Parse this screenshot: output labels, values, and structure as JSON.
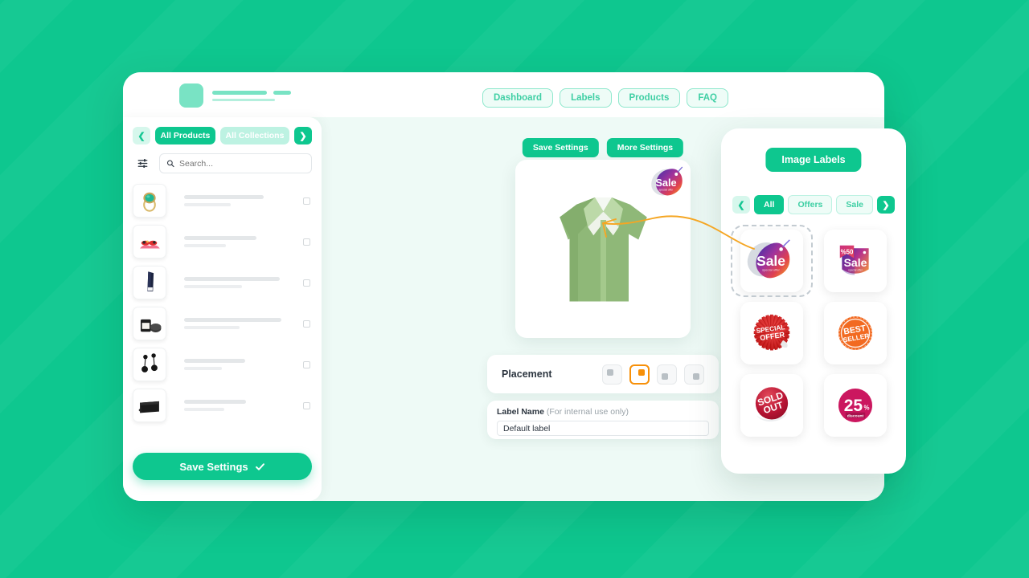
{
  "theme": {
    "brand_green": "#0ec78f",
    "light_green": "#eefcf7",
    "canvas": "#eefaf6",
    "accent_orange": "#f79009"
  },
  "header": {
    "logo_name": "app-logo",
    "nav_tabs": [
      {
        "label": "Dashboard"
      },
      {
        "label": "Labels"
      },
      {
        "label": "Products"
      },
      {
        "label": "FAQ"
      }
    ]
  },
  "sidebar": {
    "prev_icon": "chevron-left-icon",
    "next_icon": "chevron-right-icon",
    "segments": [
      {
        "label": "All Products",
        "active": true
      },
      {
        "label": "All Collections",
        "active": false
      }
    ],
    "filter_icon": "sliders-icon",
    "search": {
      "icon": "search-icon",
      "placeholder": "Search...",
      "value": ""
    },
    "products": [
      {
        "name": "product-ring",
        "checked": false
      },
      {
        "name": "product-sandals",
        "checked": false
      },
      {
        "name": "product-scarf",
        "checked": false
      },
      {
        "name": "product-candle",
        "checked": false
      },
      {
        "name": "product-earrings",
        "checked": false
      },
      {
        "name": "product-wallet",
        "checked": false
      }
    ],
    "save_button": {
      "label": "Save Settings",
      "icon": "check-icon"
    }
  },
  "center": {
    "buttons": [
      {
        "label": "Save Settings"
      },
      {
        "label": "More Settings"
      }
    ],
    "preview": {
      "product": "green-shirt",
      "badge_text": "Sale",
      "badge_sub": "special offer"
    },
    "placement": {
      "label": "Placement",
      "options": [
        {
          "position": "top-left",
          "selected": false
        },
        {
          "position": "top-right",
          "selected": true
        },
        {
          "position": "bottom-left",
          "selected": false
        },
        {
          "position": "bottom-right",
          "selected": false
        }
      ]
    },
    "label_name": {
      "title": "Label Name",
      "hint": "(For internal use only)",
      "value": "Default label"
    }
  },
  "labels_panel": {
    "title": "Image Labels",
    "prev_icon": "chevron-left-icon",
    "next_icon": "chevron-right-icon",
    "filters": [
      {
        "label": "All",
        "active": true
      },
      {
        "label": "Offers",
        "active": false
      },
      {
        "label": "Sale",
        "active": false
      }
    ],
    "stickers": [
      {
        "name": "sticker-sale-gradient",
        "text": "Sale",
        "sub": "special offer",
        "selected": true
      },
      {
        "name": "sticker-sale-50",
        "text": "Sale",
        "badge": "%50",
        "sub": "special offer",
        "selected": false
      },
      {
        "name": "sticker-special-offer",
        "line1": "SPECIAL",
        "line2": "OFFER",
        "selected": false
      },
      {
        "name": "sticker-best-seller",
        "line1": "BEST",
        "line2": "SELLER",
        "selected": false
      },
      {
        "name": "sticker-sold-out",
        "line1": "SOLD",
        "line2": "OUT",
        "selected": false
      },
      {
        "name": "sticker-25-discount",
        "text": "25",
        "unit": "%",
        "sub": "discount",
        "selected": false
      }
    ]
  },
  "annotation": {
    "arrow": "curved-arrow-from-sticker-to-preview"
  }
}
